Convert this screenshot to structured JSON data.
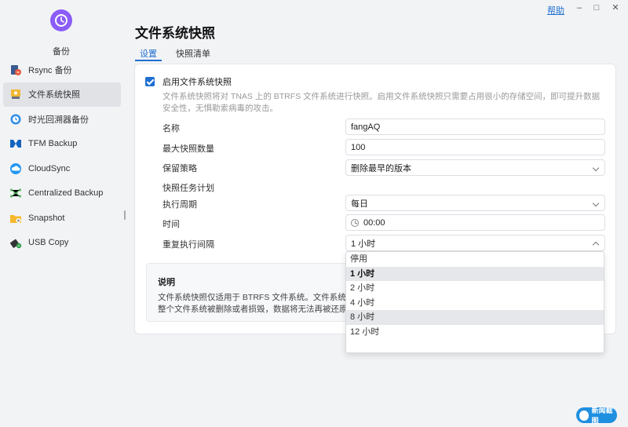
{
  "window": {
    "help_label": "帮助",
    "minimize": "–",
    "maximize": "□",
    "close": "✕"
  },
  "app": {
    "name": "备份",
    "logo_icon": "clock-icon",
    "accent_color": "#8b5cf6"
  },
  "sidebar": {
    "items": [
      {
        "label": "Rsync 备份",
        "icon": "rsync-icon"
      },
      {
        "label": "文件系统快照",
        "icon": "snapshot-disk-icon",
        "active": true
      },
      {
        "label": "时光回溯器备份",
        "icon": "time-machine-icon"
      },
      {
        "label": "TFM Backup",
        "icon": "tfm-icon"
      },
      {
        "label": "CloudSync",
        "icon": "cloud-icon"
      },
      {
        "label": "Centralized Backup",
        "icon": "network-icon"
      },
      {
        "label": "Snapshot",
        "icon": "folder-snapshot-icon"
      },
      {
        "label": "USB Copy",
        "icon": "usb-icon"
      }
    ]
  },
  "page": {
    "title": "文件系统快照",
    "tabs": [
      {
        "label": "设置",
        "active": true
      },
      {
        "label": "快照清单"
      }
    ]
  },
  "settings": {
    "enable_label": "启用文件系统快照",
    "enabled": true,
    "description": "文件系统快照将对 TNAS 上的 BTRFS 文件系统进行快照。启用文件系统快照只需要占用很小的存储空间，即可提升数据安全性，无惧勒索病毒的攻击。",
    "name_label": "名称",
    "name_value": "fangAQ",
    "max_label": "最大快照数量",
    "max_value": "100",
    "retention_label": "保留策略",
    "retention_value": "删除最早的版本",
    "schedule_heading": "快照任务计划",
    "period_label": "执行周期",
    "period_value": "每日",
    "time_label": "时间",
    "time_value": "00:00",
    "repeat_label": "重复执行间隔",
    "repeat_value": "1 小时"
  },
  "note": {
    "title": "说明",
    "line1": "文件系统快照仅适用于 BTRFS 文件系统。文件系统快",
    "line2": "整个文件系统被删除或者损毁，数据将无法再被还原。"
  },
  "dropdown": {
    "options": [
      "停用",
      "1 小时",
      "2 小时",
      "4 小时",
      "8 小时",
      "12 小时"
    ],
    "selected": "1 小时",
    "hovered": "8 小时"
  },
  "badge": {
    "text": "新闻截图"
  },
  "colors": {
    "accent": "#1f6fd1",
    "panel_bg": "#ffffff",
    "page_bg": "#f2f3f5"
  }
}
